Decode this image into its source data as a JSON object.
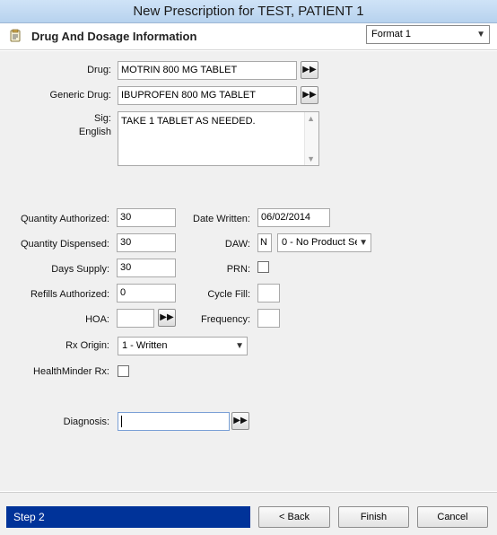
{
  "window": {
    "title": "New Prescription for TEST, PATIENT 1"
  },
  "header": {
    "title": "Drug And Dosage Information",
    "format": "Format 1"
  },
  "form": {
    "drug_label": "Drug:",
    "drug_value": "MOTRIN 800 MG TABLET",
    "generic_label": "Generic Drug:",
    "generic_value": "IBUPROFEN 800 MG TABLET",
    "sig_label": "Sig:",
    "sig_sub_label": "English",
    "sig_value": "TAKE 1 TABLET AS NEEDED.",
    "qty_auth_label": "Quantity Authorized:",
    "qty_auth_value": "30",
    "qty_disp_label": "Quantity Dispensed:",
    "qty_disp_value": "30",
    "days_supply_label": "Days Supply:",
    "days_supply_value": "30",
    "refills_label": "Refills Authorized:",
    "refills_value": "0",
    "hoa_label": "HOA:",
    "hoa_value": "",
    "rx_origin_label": "Rx Origin:",
    "rx_origin_value": "1 - Written",
    "healthminder_label": "HealthMinder Rx:",
    "date_written_label": "Date Written:",
    "date_written_value": "06/02/2014",
    "daw_label": "DAW:",
    "daw_code": "N",
    "daw_value": "0 - No Product Se",
    "prn_label": "PRN:",
    "cycle_fill_label": "Cycle Fill:",
    "cycle_fill_value": "",
    "frequency_label": "Frequency:",
    "frequency_value": "",
    "diagnosis_label": "Diagnosis:",
    "diagnosis_value": ""
  },
  "footer": {
    "step": "Step 2",
    "back": "< Back",
    "finish": "Finish",
    "cancel": "Cancel"
  },
  "colors": {
    "step_bg": "#003399",
    "panel_bg": "#f0f0f0",
    "title_bg": "#c4dbf2"
  }
}
